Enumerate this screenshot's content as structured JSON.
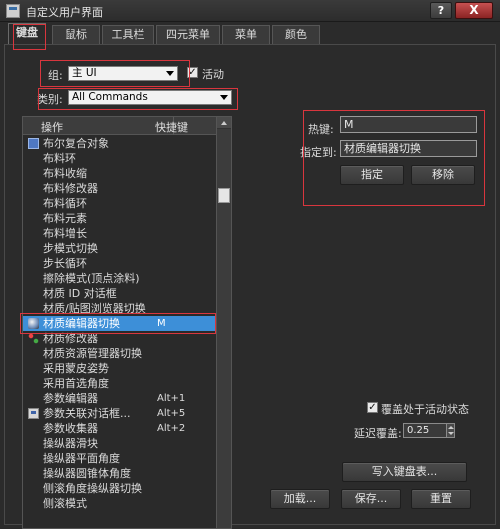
{
  "window": {
    "title": "自定义用户界面",
    "help_label": "?",
    "close_label": "X"
  },
  "tabs": [
    {
      "label": "键盘",
      "active": true
    },
    {
      "label": "鼠标"
    },
    {
      "label": "工具栏"
    },
    {
      "label": "四元菜单"
    },
    {
      "label": "菜单"
    },
    {
      "label": "颜色"
    }
  ],
  "group": {
    "label": "组:",
    "value": "主 UI",
    "active_label": "活动",
    "active_checked": true
  },
  "category": {
    "label": "类别:",
    "value": "All Commands"
  },
  "list": {
    "col_action": "操作",
    "col_shortcut": "快捷键",
    "rows": [
      {
        "name": "布尔复合对象",
        "key": "",
        "icon": "blue"
      },
      {
        "name": "布料环",
        "key": ""
      },
      {
        "name": "布料收缩",
        "key": ""
      },
      {
        "name": "布料修改器",
        "key": ""
      },
      {
        "name": "布料循环",
        "key": ""
      },
      {
        "name": "布料元素",
        "key": ""
      },
      {
        "name": "布料增长",
        "key": ""
      },
      {
        "name": "步模式切换",
        "key": ""
      },
      {
        "name": "步长循环",
        "key": ""
      },
      {
        "name": "擦除模式(顶点涂料)",
        "key": ""
      },
      {
        "name": "材质 ID 对话框",
        "key": ""
      },
      {
        "name": "材质/贴图浏览器切换",
        "key": ""
      },
      {
        "name": "材质编辑器切换",
        "key": "M",
        "icon": "mat",
        "selected": true
      },
      {
        "name": "材质修改器",
        "key": "",
        "icon": "dots"
      },
      {
        "name": "材质资源管理器切换",
        "key": ""
      },
      {
        "name": "采用蒙皮姿势",
        "key": ""
      },
      {
        "name": "采用首选角度",
        "key": ""
      },
      {
        "name": "参数编辑器",
        "key": "Alt+1"
      },
      {
        "name": "参数关联对话框...",
        "key": "Alt+5",
        "icon": "dialog"
      },
      {
        "name": "参数收集器",
        "key": "Alt+2"
      },
      {
        "name": "操纵器滑块",
        "key": ""
      },
      {
        "name": "操纵器平面角度",
        "key": ""
      },
      {
        "name": "操纵器圆锥体角度",
        "key": ""
      },
      {
        "name": "侧滚角度操纵器切换",
        "key": ""
      },
      {
        "name": "侧滚模式",
        "key": ""
      }
    ]
  },
  "hotkey": {
    "label": "热键:",
    "value": "M",
    "assigned_label": "指定到:",
    "assigned_value": "材质编辑器切换",
    "assign_button": "指定",
    "remove_button": "移除"
  },
  "override": {
    "label": "覆盖处于活动状态",
    "checked": true,
    "delay_label": "延迟覆盖:",
    "delay_value": "0.25"
  },
  "buttons": {
    "write_table": "写入键盘表...",
    "load": "加载...",
    "save": "保存...",
    "reset": "重置"
  },
  "highlight_color": "#d9363e",
  "selection_color": "#3d8fd8"
}
